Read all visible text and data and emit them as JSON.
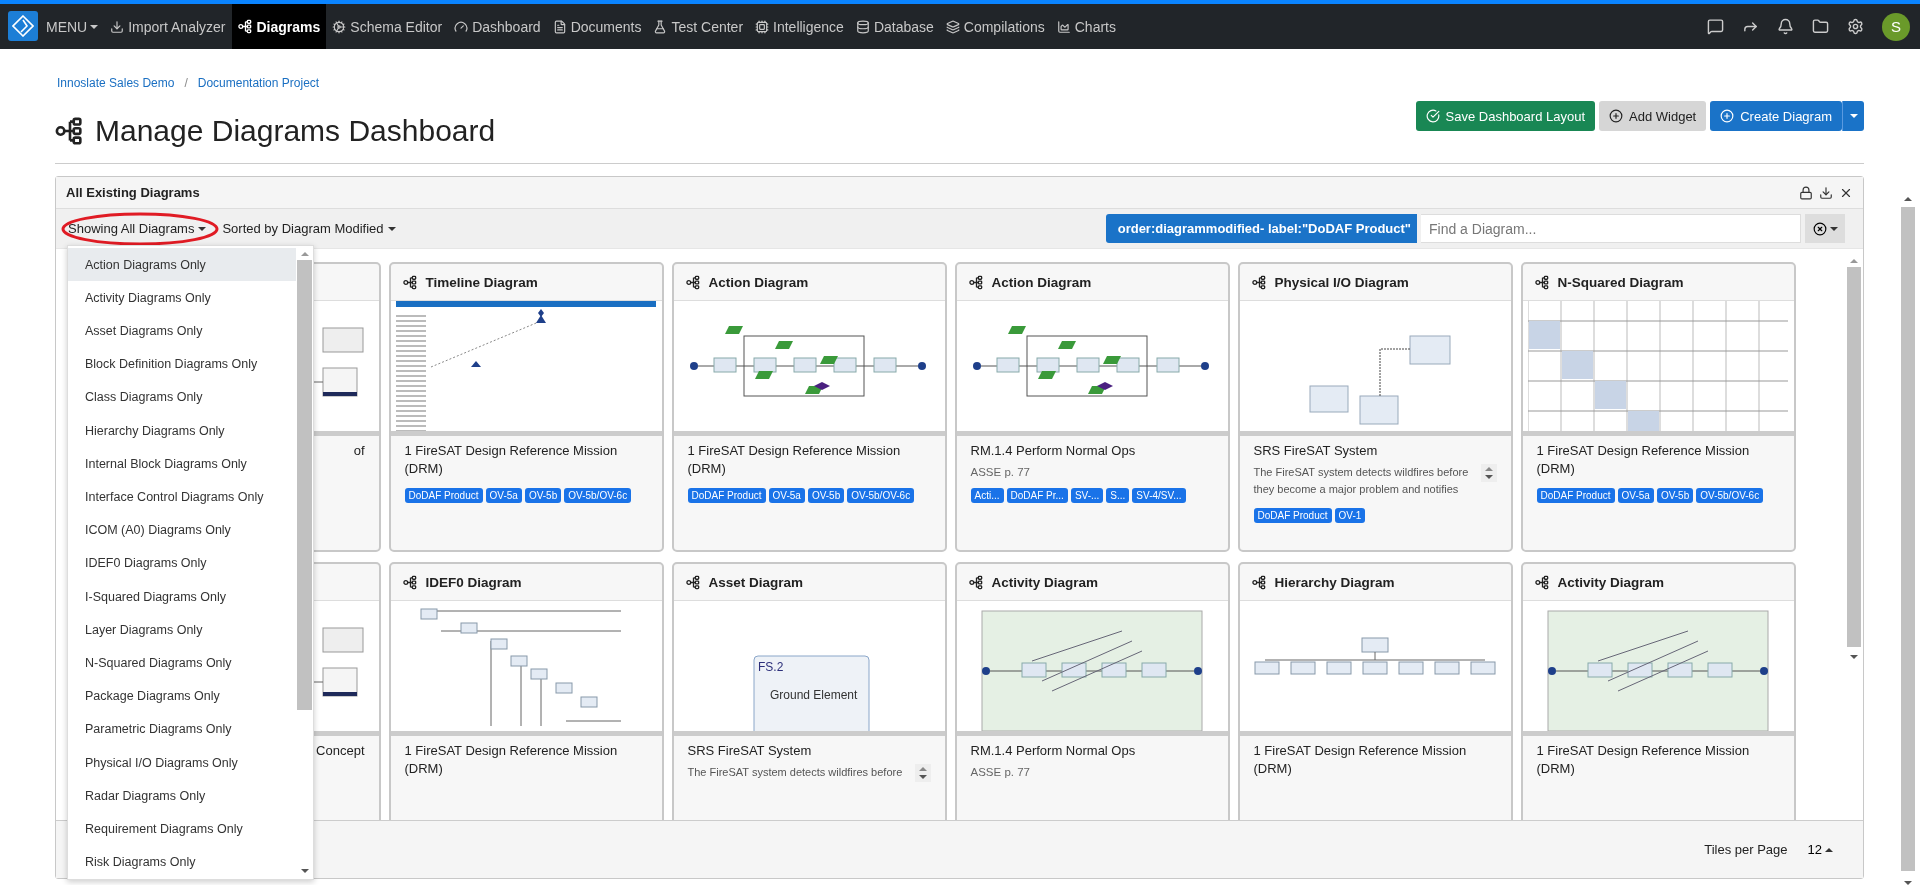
{
  "nav": {
    "menu_label": "MENU",
    "items": [
      {
        "label": "Import Analyzer",
        "selected": false
      },
      {
        "label": "Diagrams",
        "selected": true
      },
      {
        "label": "Schema Editor",
        "selected": false
      },
      {
        "label": "Dashboard",
        "selected": false
      },
      {
        "label": "Documents",
        "selected": false
      },
      {
        "label": "Test Center",
        "selected": false
      },
      {
        "label": "Intelligence",
        "selected": false
      },
      {
        "label": "Database",
        "selected": false
      },
      {
        "label": "Compilations",
        "selected": false
      },
      {
        "label": "Charts",
        "selected": false
      }
    ],
    "avatar": "S"
  },
  "breadcrumb": {
    "items": [
      "Innoslate Sales Demo",
      "Documentation Project"
    ],
    "separator": "/"
  },
  "page_title": "Manage Diagrams Dashboard",
  "actions": [
    {
      "label": "Save Dashboard Layout",
      "kind": "success"
    },
    {
      "label": "Add Widget",
      "kind": "neutral"
    },
    {
      "label": "Create Diagram",
      "kind": "primary"
    }
  ],
  "panel": {
    "title": "All Existing Diagrams",
    "filter": "Showing All Diagrams",
    "sort": "Sorted by Diagram Modified",
    "query_chip": "order:diagrammodified- label:\"DoDAF Product\"",
    "search": {
      "placeholder": "Find a Diagram..."
    },
    "filter_menu": {
      "items": [
        {
          "label": "Action Diagrams Only",
          "selected": true
        },
        {
          "label": "Activity Diagrams Only",
          "selected": false
        },
        {
          "label": "Asset Diagrams Only",
          "selected": false
        },
        {
          "label": "Block Definition Diagrams Only",
          "selected": false
        },
        {
          "label": "Class Diagrams Only",
          "selected": false
        },
        {
          "label": "Hierarchy Diagrams Only",
          "selected": false
        },
        {
          "label": "Internal Block Diagrams Only",
          "selected": false
        },
        {
          "label": "Interface Control Diagrams Only",
          "selected": false
        },
        {
          "label": "ICOM (A0) Diagrams Only",
          "selected": false
        },
        {
          "label": "IDEF0 Diagrams Only",
          "selected": false
        },
        {
          "label": "I-Squared Diagrams Only",
          "selected": false
        },
        {
          "label": "Layer Diagrams Only",
          "selected": false
        },
        {
          "label": "N-Squared Diagrams Only",
          "selected": false
        },
        {
          "label": "Package Diagrams Only",
          "selected": false
        },
        {
          "label": "Parametric Diagrams Only",
          "selected": false
        },
        {
          "label": "Physical I/O Diagrams Only",
          "selected": false
        },
        {
          "label": "Radar Diagrams Only",
          "selected": false
        },
        {
          "label": "Requirement Diagrams Only",
          "selected": false
        },
        {
          "label": "Risk Diagrams Only",
          "selected": false
        }
      ]
    },
    "cards": [
      {
        "covered": true,
        "kind": "block",
        "name": "of"
      },
      {
        "title": "Timeline Diagram",
        "kind": "timeline",
        "name": "1 FireSAT Design Reference Mission (DRM)",
        "tags": [
          "DoDAF Product",
          "OV-5a",
          "OV-5b",
          "OV-5b/OV-6c"
        ]
      },
      {
        "title": "Action Diagram",
        "kind": "flow",
        "name": "1 FireSAT Design Reference Mission (DRM)",
        "tags": [
          "DoDAF Product",
          "OV-5a",
          "OV-5b",
          "OV-5b/OV-6c"
        ]
      },
      {
        "title": "Action Diagram",
        "kind": "flow",
        "name": "RM.1.4 Perform Normal Ops",
        "subtitle": "ASSE p. 77",
        "tags": [
          "Acti...",
          "DoDAF Pr...",
          "SV-...",
          "S...",
          "SV-4/SV..."
        ]
      },
      {
        "title": "Physical I/O Diagram",
        "kind": "io",
        "name": "SRS FireSAT System",
        "description": "The FireSAT system detects wildfires before they become a major problem and notifies",
        "tags": [
          "DoDAF Product",
          "OV-1"
        ]
      },
      {
        "title": "N-Squared Diagram",
        "kind": "nsquared",
        "name": "1 FireSAT Design Reference Mission (DRM)",
        "tags": [
          "DoDAF Product",
          "OV-5a",
          "OV-5b",
          "OV-5b/OV-6c"
        ]
      },
      {
        "covered": true,
        "kind": "block",
        "name": "Concept"
      },
      {
        "title": "IDEF0 Diagram",
        "kind": "idef0",
        "name": "1 FireSAT Design Reference Mission (DRM)"
      },
      {
        "title": "Asset Diagram",
        "kind": "asset",
        "name": "SRS FireSAT System",
        "description": "The FireSAT system detects wildfires before",
        "labels": [
          "FS.2",
          "Ground Element"
        ]
      },
      {
        "title": "Activity Diagram",
        "kind": "activity",
        "name": "RM.1.4 Perform Normal Ops",
        "subtitle": "ASSE p. 77"
      },
      {
        "title": "Hierarchy Diagram",
        "kind": "hierarchy",
        "name": "1 FireSAT Design Reference Mission (DRM)"
      },
      {
        "title": "Activity Diagram",
        "kind": "activity",
        "name": "1 FireSAT Design Reference Mission (DRM)"
      }
    ],
    "tiles_label": "Tiles per Page",
    "tiles_value": "12"
  }
}
